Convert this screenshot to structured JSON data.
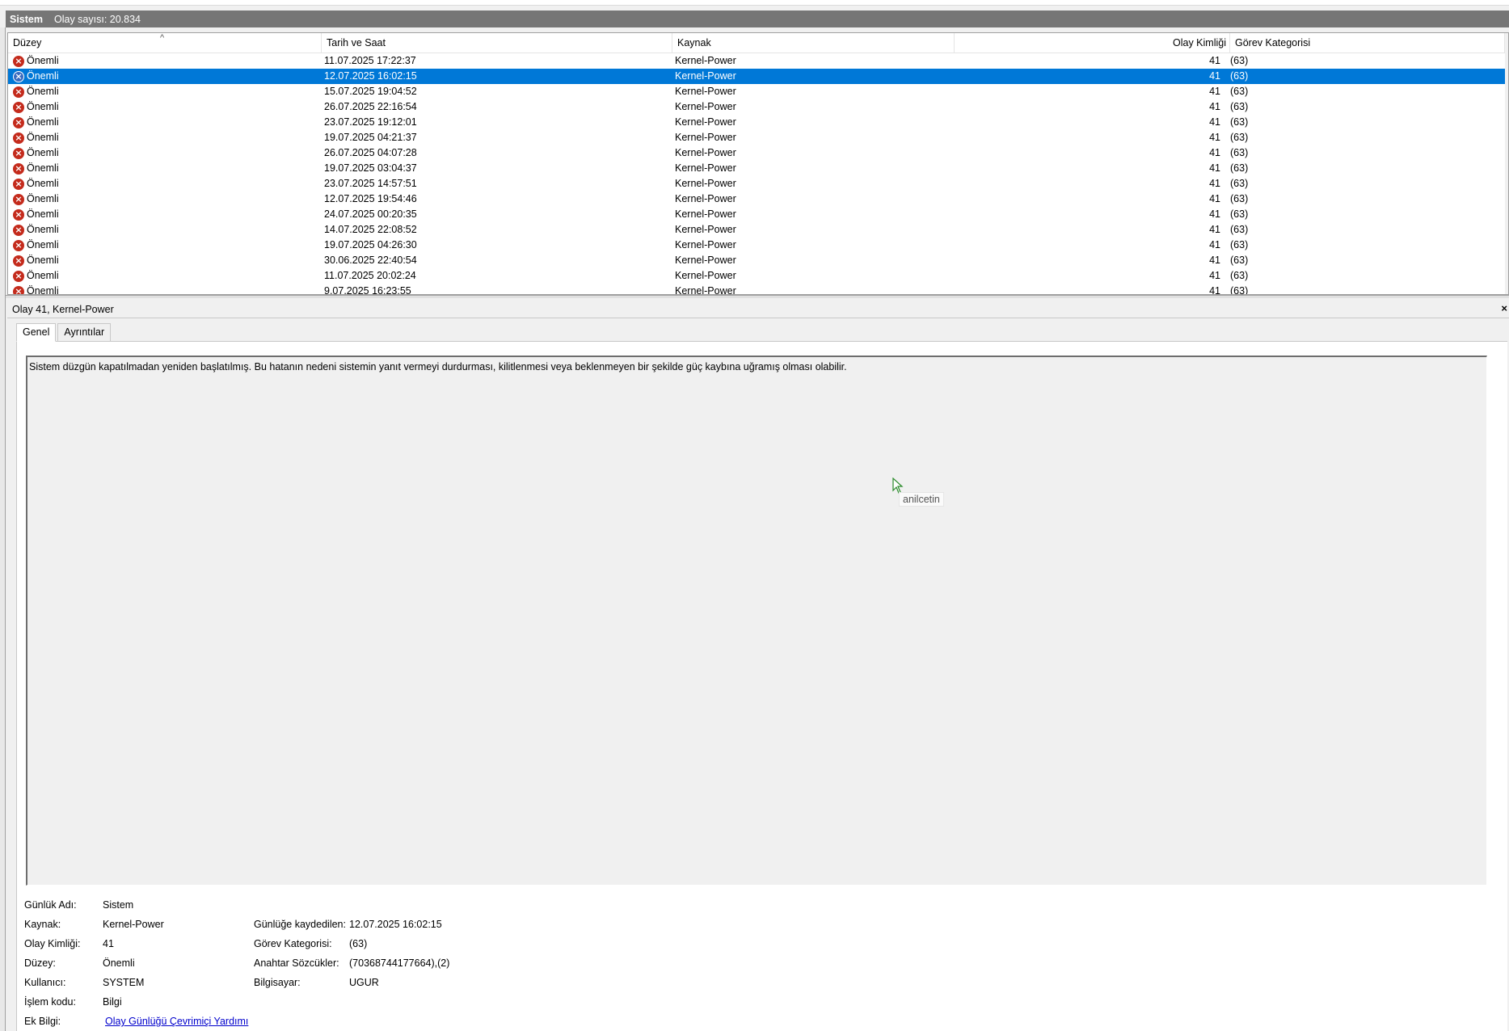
{
  "log_header": {
    "name": "Sistem",
    "event_count": "Olay sayısı: 20.834"
  },
  "columns": {
    "level": "Düzey",
    "datetime": "Tarih ve Saat",
    "source": "Kaynak",
    "event_id": "Olay Kimliği",
    "task_category": "Görev Kategorisi"
  },
  "events": [
    {
      "level": "Önemli",
      "datetime": "11.07.2025 17:22:37",
      "source": "Kernel-Power",
      "event_id": "41",
      "task_category": "(63)"
    },
    {
      "level": "Önemli",
      "datetime": "12.07.2025 16:02:15",
      "source": "Kernel-Power",
      "event_id": "41",
      "task_category": "(63)"
    },
    {
      "level": "Önemli",
      "datetime": "15.07.2025 19:04:52",
      "source": "Kernel-Power",
      "event_id": "41",
      "task_category": "(63)"
    },
    {
      "level": "Önemli",
      "datetime": "26.07.2025 22:16:54",
      "source": "Kernel-Power",
      "event_id": "41",
      "task_category": "(63)"
    },
    {
      "level": "Önemli",
      "datetime": "23.07.2025 19:12:01",
      "source": "Kernel-Power",
      "event_id": "41",
      "task_category": "(63)"
    },
    {
      "level": "Önemli",
      "datetime": "19.07.2025 04:21:37",
      "source": "Kernel-Power",
      "event_id": "41",
      "task_category": "(63)"
    },
    {
      "level": "Önemli",
      "datetime": "26.07.2025 04:07:28",
      "source": "Kernel-Power",
      "event_id": "41",
      "task_category": "(63)"
    },
    {
      "level": "Önemli",
      "datetime": "19.07.2025 03:04:37",
      "source": "Kernel-Power",
      "event_id": "41",
      "task_category": "(63)"
    },
    {
      "level": "Önemli",
      "datetime": "23.07.2025 14:57:51",
      "source": "Kernel-Power",
      "event_id": "41",
      "task_category": "(63)"
    },
    {
      "level": "Önemli",
      "datetime": "12.07.2025 19:54:46",
      "source": "Kernel-Power",
      "event_id": "41",
      "task_category": "(63)"
    },
    {
      "level": "Önemli",
      "datetime": "24.07.2025 00:20:35",
      "source": "Kernel-Power",
      "event_id": "41",
      "task_category": "(63)"
    },
    {
      "level": "Önemli",
      "datetime": "14.07.2025 22:08:52",
      "source": "Kernel-Power",
      "event_id": "41",
      "task_category": "(63)"
    },
    {
      "level": "Önemli",
      "datetime": "19.07.2025 04:26:30",
      "source": "Kernel-Power",
      "event_id": "41",
      "task_category": "(63)"
    },
    {
      "level": "Önemli",
      "datetime": "30.06.2025 22:40:54",
      "source": "Kernel-Power",
      "event_id": "41",
      "task_category": "(63)"
    },
    {
      "level": "Önemli",
      "datetime": "11.07.2025 20:02:24",
      "source": "Kernel-Power",
      "event_id": "41",
      "task_category": "(63)"
    },
    {
      "level": "Önemli",
      "datetime": "9.07.2025 16:23:55",
      "source": "Kernel-Power",
      "event_id": "41",
      "task_category": "(63)"
    }
  ],
  "selected_index": 1,
  "detail": {
    "title": "Olay 41, Kernel-Power",
    "close_glyph": "×",
    "tabs": [
      "Genel",
      "Ayrıntılar"
    ],
    "message": "Sistem düzgün kapatılmadan yeniden başlatılmış. Bu hatanın nedeni sistemin yanıt vermeyi durdurması, kilitlenmesi veya beklenmeyen bir şekilde güç kaybına uğramış olması olabilir.",
    "tooltip": "anilcetin",
    "properties": {
      "log_name_label": "Günlük Adı:",
      "log_name": "Sistem",
      "source_label": "Kaynak:",
      "source": "Kernel-Power",
      "logged_label": "Günlüğe kaydedilen:",
      "logged": "12.07.2025 16:02:15",
      "event_id_label": "Olay Kimliği:",
      "event_id": "41",
      "task_category_label": "Görev Kategorisi:",
      "task_category": "(63)",
      "level_label": "Düzey:",
      "level": "Önemli",
      "keywords_label": "Anahtar Sözcükler:",
      "keywords": "(70368744177664),(2)",
      "user_label": "Kullanıcı:",
      "user": "SYSTEM",
      "computer_label": "Bilgisayar:",
      "computer": "UGUR",
      "opcode_label": "İşlem kodu:",
      "opcode": "Bilgi",
      "more_info_label": "Ek Bilgi:",
      "more_info_link": "Olay Günlüğü Çevrimiçi Yardımı"
    }
  },
  "colors": {
    "selection": "#0078d7",
    "header_bar": "#767676",
    "error_icon": "#c42b1c",
    "link": "#0000cc"
  },
  "icons": {
    "row_level": "error-icon",
    "sort": "sort-ascending-icon",
    "cursor": "mouse-pointer-icon"
  }
}
